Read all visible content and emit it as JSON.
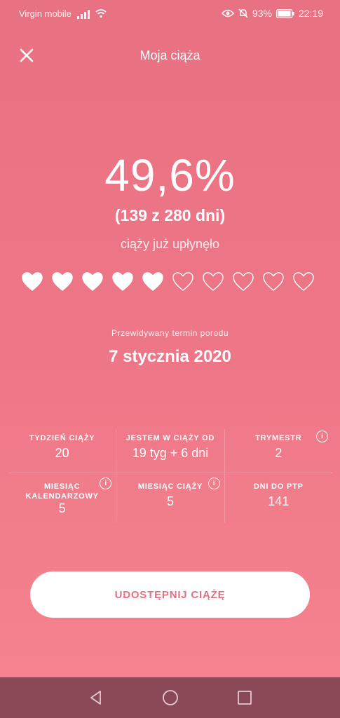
{
  "status_bar": {
    "carrier": "Virgin mobile",
    "battery": "93%",
    "time": "22:19"
  },
  "header": {
    "title": "Moja ciąża",
    "close_icon": "close-icon"
  },
  "progress": {
    "percent_text": "49,6%",
    "days_text": "(139 z 280 dni)",
    "caption": "ciąży już upłynęło",
    "hearts_total": 10,
    "hearts_filled": 5
  },
  "due": {
    "label": "Przewidywany termin porodu",
    "date": "7 stycznia 2020"
  },
  "stats": [
    {
      "label": "TYDZIEŃ CIĄŻY",
      "value": "20",
      "info": false
    },
    {
      "label": "JESTEM W CIĄŻY OD",
      "value": "19 tyg + 6 dni",
      "info": false
    },
    {
      "label": "TRYMESTR",
      "value": "2",
      "info": true
    },
    {
      "label": "MIESIĄC KALENDARZOWY",
      "value": "5",
      "info": true
    },
    {
      "label": "MIESIĄC CIĄŻY",
      "value": "5",
      "info": true
    },
    {
      "label": "DNI DO PTP",
      "value": "141",
      "info": false
    }
  ],
  "share_button": "UDOSTĘPNIJ CIĄŻĘ",
  "info_glyph": "i",
  "colors": {
    "accent": "#ee7787",
    "button_text": "#e5707f",
    "navbar": "#8a4957"
  }
}
